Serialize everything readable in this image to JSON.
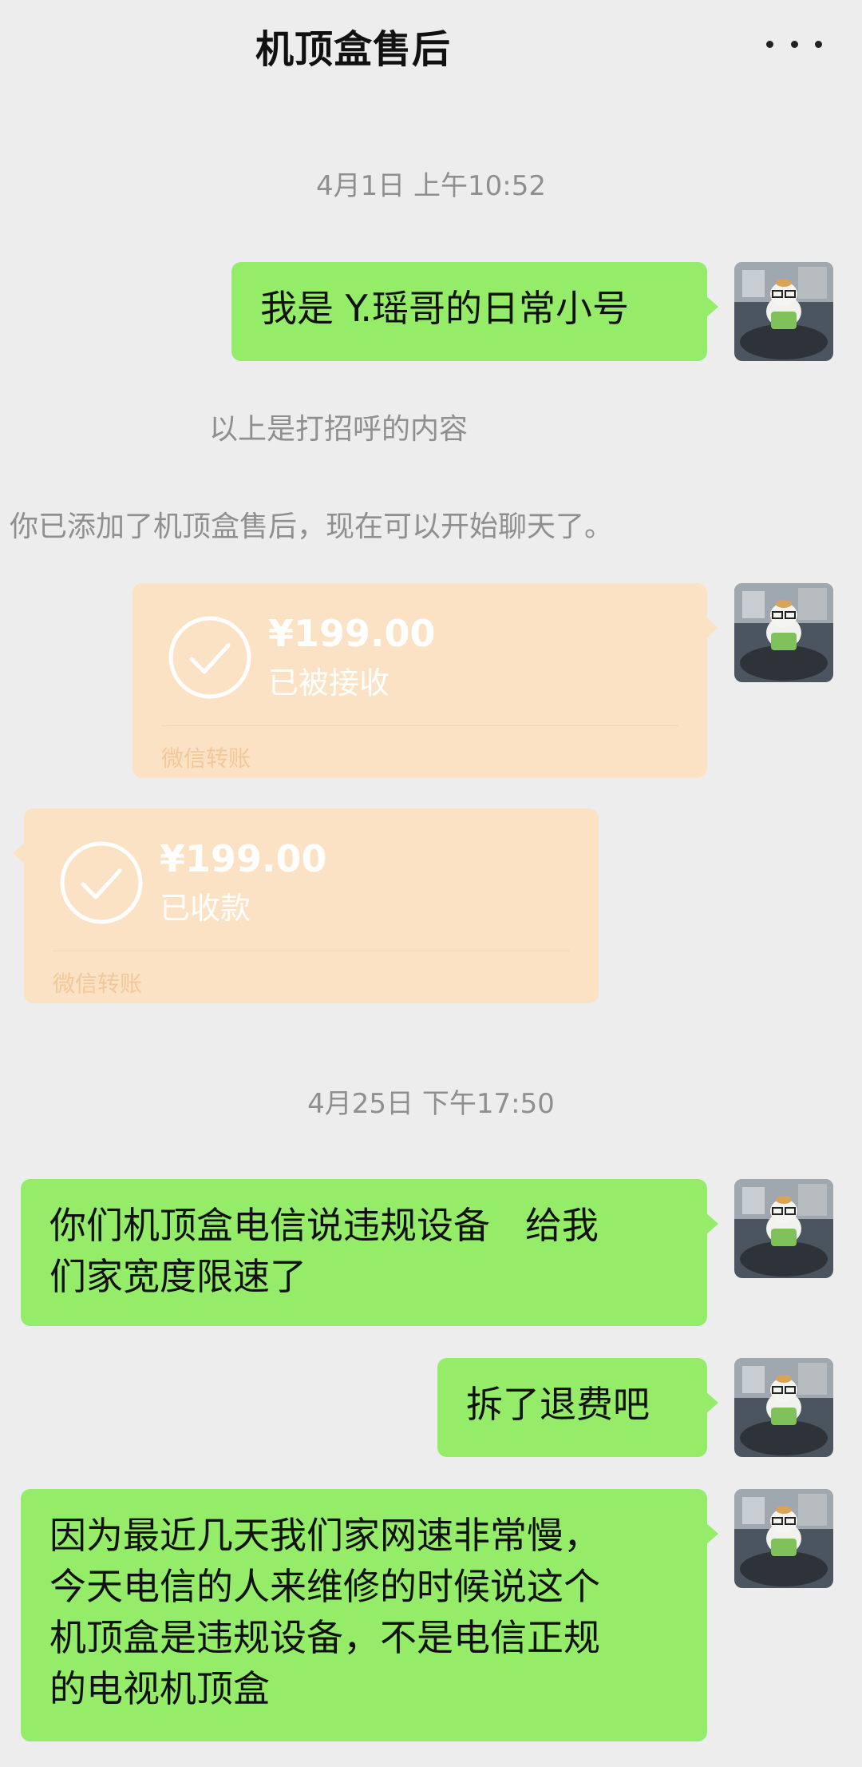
{
  "header": {
    "title": "机顶盒售后"
  },
  "messages": {
    "ts1": "4月1日 上午10:52",
    "m1": "我是 Y.瑶哥的日常小号",
    "sys1": "以上是打招呼的内容",
    "sys2": "你已添加了机顶盒售后，现在可以开始聊天了。",
    "transfer1": {
      "amount": "¥199.00",
      "status": "已被接收",
      "source": "微信转账"
    },
    "transfer2": {
      "amount": "¥199.00",
      "status": "已收款",
      "source": "微信转账"
    },
    "ts2": "4月25日 下午17:50",
    "m2_line1": "你们机顶盒电信说违规设备   给我",
    "m2_line2": "们家宽度限速了",
    "m3": "拆了退费吧",
    "m4_line1": "因为最近几天我们家网速非常慢，",
    "m4_line2": "今天电信的人来维修的时候说这个",
    "m4_line3": "机顶盒是违规设备，不是电信正规",
    "m4_line4": "的电视机顶盒"
  },
  "colors": {
    "background": "#ededed",
    "sent_bubble": "#95ec69",
    "transfer_card": "#fbe2c5",
    "muted_text": "#8f8f8f"
  },
  "icons": {
    "more": "more-dots-icon",
    "transfer_done": "check-circle-icon",
    "avatar": "avatar-image"
  }
}
